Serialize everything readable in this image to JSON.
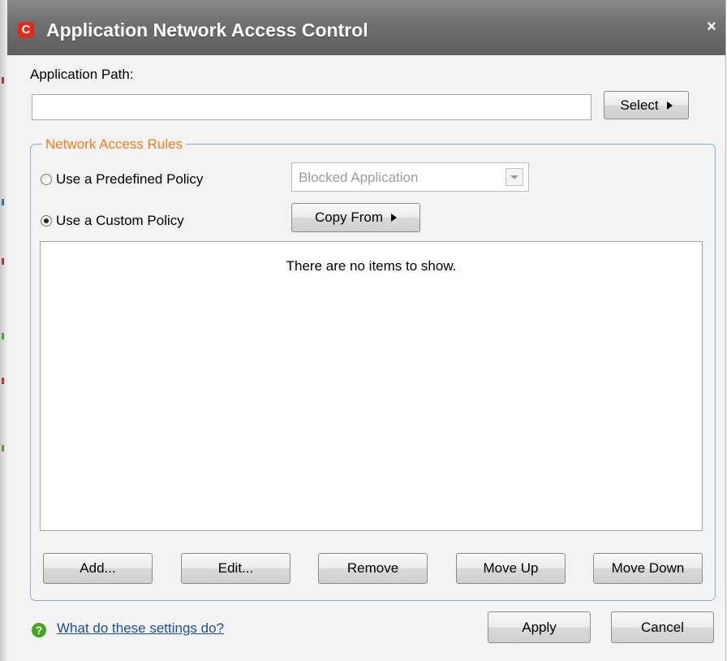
{
  "window": {
    "title": "Application Network Access Control",
    "logo_letter": "C",
    "close_glyph": "×"
  },
  "app_path": {
    "label": "Application Path:",
    "value": "",
    "select_label": "Select"
  },
  "rules": {
    "group_title": "Network Access Rules",
    "predefined_label": "Use a Predefined Policy",
    "predefined_selected": false,
    "predefined_value": "Blocked Application",
    "custom_label": "Use a Custom Policy",
    "custom_selected": true,
    "copy_from_label": "Copy From",
    "empty_message": "There are no items to show.",
    "buttons": {
      "add": "Add...",
      "edit": "Edit...",
      "remove": "Remove",
      "move_up": "Move Up",
      "move_down": "Move Down"
    }
  },
  "footer": {
    "help_glyph": "?",
    "help_link": "What do these settings do?",
    "apply_label": "Apply",
    "cancel_label": "Cancel"
  },
  "colors": {
    "titlebar": "#6f6f6f",
    "accent_orange": "#f07c1c",
    "group_border": "#8aaed6",
    "logo_red": "#e02a20",
    "help_green": "#46a324"
  },
  "icons": [
    "app-logo-icon",
    "close-icon",
    "arrow-right-icon",
    "dropdown-arrow-icon",
    "help-icon"
  ]
}
